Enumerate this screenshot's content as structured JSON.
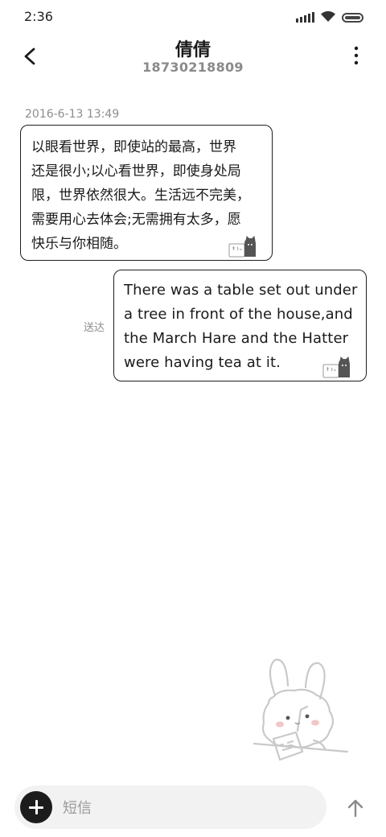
{
  "status_bar": {
    "time": "2:36",
    "icons": [
      "signal-icon",
      "wifi-icon",
      "battery-icon"
    ]
  },
  "header": {
    "contact_name": "倩倩",
    "contact_number": "18730218809",
    "back_icon": "chevron-left-icon",
    "more_icon": "more-vertical-icon"
  },
  "conversation": {
    "timestamp": "2016-6-13 13:49",
    "messages": [
      {
        "direction": "incoming",
        "lines": [
          "以眼看世界，即使站的最高，世界",
          "还是很小;以心看世界，即使身处局",
          "限，世界依然很大。生活远不完美，",
          "需要用心去体会;无需拥有太多，愿",
          "快乐与你相随。"
        ]
      },
      {
        "direction": "outgoing",
        "status": "送达",
        "lines": [
          "There was a table set out under",
          "a tree in front of the house,and",
          "the March Hare and the Hatter",
          "were having tea at it."
        ]
      }
    ]
  },
  "composer": {
    "placeholder": "短信",
    "value": "",
    "add_icon": "plus-icon",
    "send_icon": "arrow-up-icon"
  },
  "colors": {
    "bubble_border": "#1f1f1f",
    "input_bg": "#f2f2f2",
    "secondary_text": "#8d8d8d",
    "add_button": "#1c1c1c"
  }
}
